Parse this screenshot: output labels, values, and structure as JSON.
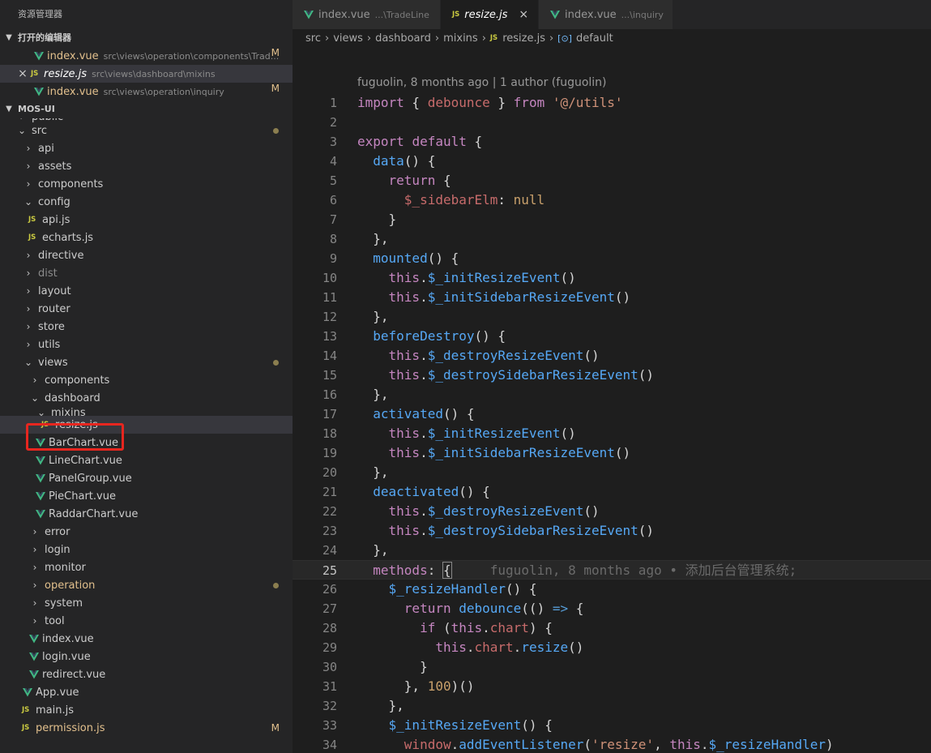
{
  "explorer": {
    "title": "资源管理器",
    "open_editors": {
      "header": "打开的编辑器",
      "items": [
        {
          "name": "index.vue",
          "path": "src\\views\\operation\\components\\Trad...",
          "badge": "M",
          "icon": "vue-icon"
        },
        {
          "name": "resize.js",
          "path": "src\\views\\dashboard\\mixins",
          "badge": "",
          "icon": "js-icon"
        },
        {
          "name": "index.vue",
          "path": "src\\views\\operation\\inquiry",
          "badge": "M",
          "icon": "vue-icon"
        }
      ]
    },
    "project": {
      "header": "MOS-UI",
      "tree": [
        {
          "label": "public"
        },
        {
          "label": "src"
        },
        {
          "label": "api"
        },
        {
          "label": "assets"
        },
        {
          "label": "components"
        },
        {
          "label": "config"
        },
        {
          "label": "api.js"
        },
        {
          "label": "echarts.js"
        },
        {
          "label": "directive"
        },
        {
          "label": "dist"
        },
        {
          "label": "layout"
        },
        {
          "label": "router"
        },
        {
          "label": "store"
        },
        {
          "label": "utils"
        },
        {
          "label": "views"
        },
        {
          "label": "components"
        },
        {
          "label": "dashboard"
        },
        {
          "label": "mixins"
        },
        {
          "label": "resize.js"
        },
        {
          "label": "BarChart.vue"
        },
        {
          "label": "LineChart.vue"
        },
        {
          "label": "PanelGroup.vue"
        },
        {
          "label": "PieChart.vue"
        },
        {
          "label": "RaddarChart.vue"
        },
        {
          "label": "error"
        },
        {
          "label": "login"
        },
        {
          "label": "monitor"
        },
        {
          "label": "operation"
        },
        {
          "label": "system"
        },
        {
          "label": "tool"
        },
        {
          "label": "index.vue"
        },
        {
          "label": "login.vue"
        },
        {
          "label": "redirect.vue"
        },
        {
          "label": "App.vue"
        },
        {
          "label": "main.js"
        },
        {
          "label": "permission.js",
          "badge": "M"
        }
      ]
    }
  },
  "tabs": [
    {
      "name": "index.vue",
      "desc": "...\\TradeLine",
      "icon": "vue-icon"
    },
    {
      "name": "resize.js",
      "desc": "",
      "icon": "js-icon",
      "close": "×"
    },
    {
      "name": "index.vue",
      "desc": "...\\inquiry",
      "icon": "vue-icon"
    }
  ],
  "breadcrumb": [
    "src",
    "views",
    "dashboard",
    "mixins",
    "resize.js",
    "default"
  ],
  "editor": {
    "blame_header": "fuguolin, 8 months ago | 1 author (fuguolin)",
    "inline_blame": "fuguolin, 8 months ago • 添加后台管理系统;",
    "line_numbers": [
      "1",
      "2",
      "3",
      "4",
      "5",
      "6",
      "7",
      "8",
      "9",
      "10",
      "11",
      "12",
      "13",
      "14",
      "15",
      "16",
      "17",
      "18",
      "19",
      "20",
      "21",
      "22",
      "23",
      "24",
      "25",
      "26",
      "27",
      "28",
      "29",
      "30",
      "31",
      "32",
      "33",
      "34"
    ]
  },
  "icons": {
    "js": "JS",
    "chevron_right": "›",
    "chevron_down": "⌄",
    "close": "×"
  }
}
